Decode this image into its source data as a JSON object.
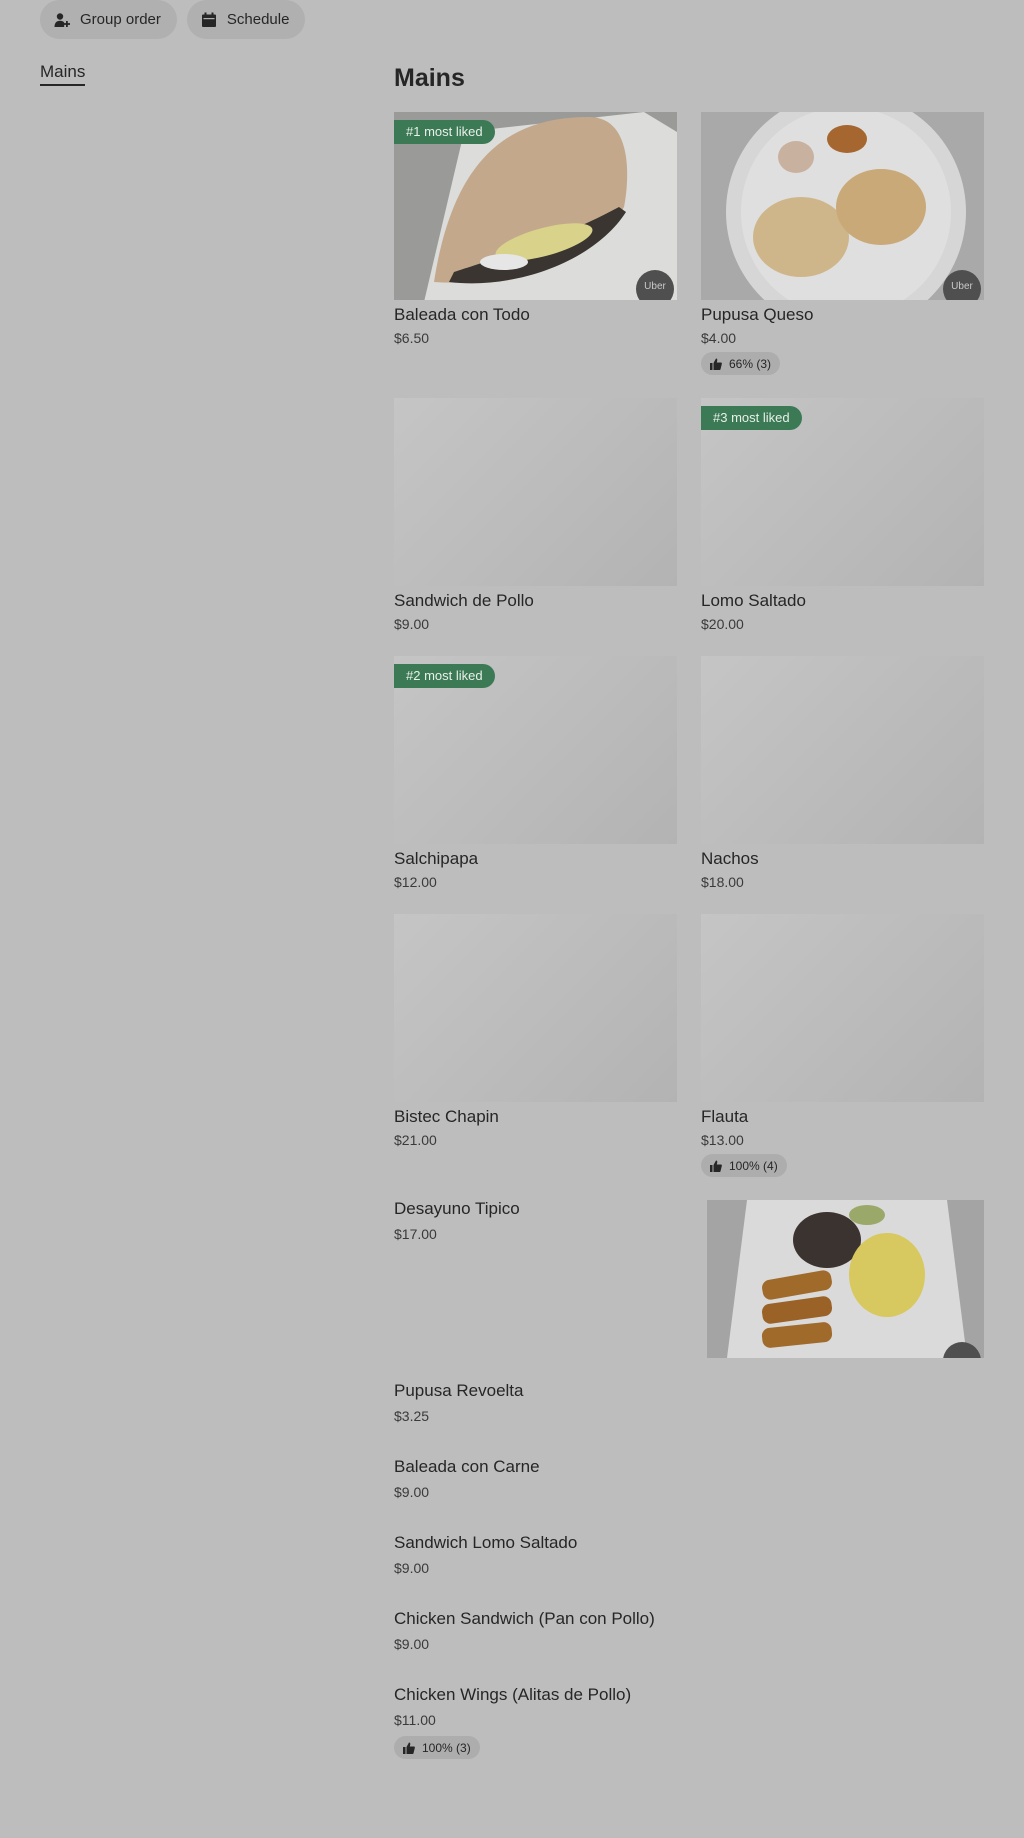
{
  "toolbar": {
    "group_order_label": "Group order",
    "schedule_label": "Schedule"
  },
  "sidebar": {
    "items": [
      {
        "label": "Mains"
      }
    ]
  },
  "section": {
    "title": "Mains"
  },
  "grid_items": [
    {
      "name": "Baleada con Todo",
      "price": "$6.50",
      "badge": "#1 most liked",
      "chip": "Uber"
    },
    {
      "name": "Pupusa Queso",
      "price": "$4.00",
      "rating": "66% (3)",
      "chip": "Uber"
    },
    {
      "name": "Sandwich de Pollo",
      "price": "$9.00"
    },
    {
      "name": "Lomo Saltado",
      "price": "$20.00",
      "badge": "#3 most liked"
    },
    {
      "name": "Salchipapa",
      "price": "$12.00",
      "badge": "#2 most liked"
    },
    {
      "name": "Nachos",
      "price": "$18.00"
    },
    {
      "name": "Bistec Chapin",
      "price": "$21.00"
    },
    {
      "name": "Flauta",
      "price": "$13.00",
      "rating": "100% (4)"
    }
  ],
  "featured_item": {
    "name": "Desayuno Tipico",
    "price": "$17.00"
  },
  "list_items": [
    {
      "name": "Pupusa Revoelta",
      "price": "$3.25"
    },
    {
      "name": "Baleada con Carne",
      "price": "$9.00"
    },
    {
      "name": "Sandwich Lomo Saltado",
      "price": "$9.00"
    },
    {
      "name": "Chicken Sandwich (Pan con Pollo)",
      "price": "$9.00"
    },
    {
      "name": "Chicken Wings (Alitas de Pollo)",
      "price": "$11.00",
      "rating": "100% (3)"
    }
  ],
  "colors": {
    "badge_green": "#3c7a56",
    "background": "#bdbdbd",
    "text": "#262626"
  }
}
